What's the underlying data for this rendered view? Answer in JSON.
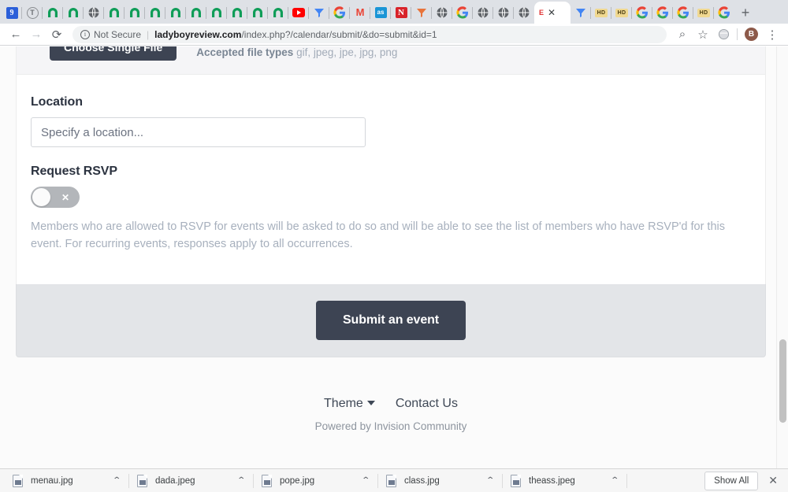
{
  "browser": {
    "tabs": [
      {
        "name": "tab-favicon-blue9",
        "icon": "blue-square-9-icon"
      },
      {
        "name": "tab-favicon-circle-t",
        "icon": "circled-t-icon"
      },
      {
        "name": "tab-favicon-arch-1",
        "icon": "green-arch-icon"
      },
      {
        "name": "tab-favicon-arch-2",
        "icon": "green-arch-icon"
      },
      {
        "name": "tab-favicon-globe-1",
        "icon": "globe-icon"
      },
      {
        "name": "tab-favicon-arch-3",
        "icon": "green-arch-icon"
      },
      {
        "name": "tab-favicon-arch-4",
        "icon": "green-arch-icon"
      },
      {
        "name": "tab-favicon-arch-5",
        "icon": "green-arch-icon"
      },
      {
        "name": "tab-favicon-arch-6",
        "icon": "green-arch-icon"
      },
      {
        "name": "tab-favicon-arch-7",
        "icon": "green-arch-icon"
      },
      {
        "name": "tab-favicon-arch-8",
        "icon": "green-arch-icon"
      },
      {
        "name": "tab-favicon-arch-9",
        "icon": "green-arch-icon"
      },
      {
        "name": "tab-favicon-arch-10",
        "icon": "green-arch-icon"
      },
      {
        "name": "tab-favicon-arch-11",
        "icon": "green-arch-icon"
      },
      {
        "name": "tab-favicon-youtube",
        "icon": "youtube-icon"
      },
      {
        "name": "tab-favicon-vimeo-1",
        "icon": "blue-funnel-icon"
      },
      {
        "name": "tab-favicon-google-1",
        "icon": "google-g-icon",
        "label": "G"
      },
      {
        "name": "tab-favicon-gmail",
        "icon": "gmail-m-icon",
        "label": "M"
      },
      {
        "name": "tab-favicon-as",
        "icon": "blue-as-icon",
        "label": "as"
      },
      {
        "name": "tab-favicon-n",
        "icon": "red-n-icon",
        "label": "N"
      },
      {
        "name": "tab-favicon-vimeo-2",
        "icon": "blue-funnel-icon"
      },
      {
        "name": "tab-favicon-globe-2",
        "icon": "globe-icon"
      },
      {
        "name": "tab-favicon-google-2",
        "icon": "google-g-icon",
        "label": "G"
      },
      {
        "name": "tab-favicon-globe-3",
        "icon": "globe-icon"
      },
      {
        "name": "tab-favicon-globe-4",
        "icon": "globe-icon"
      },
      {
        "name": "tab-favicon-globe-5",
        "icon": "globe-icon"
      }
    ],
    "active_tab": {
      "favicon": "red-text-icon",
      "favicon_label": "E",
      "close_label": "✕"
    },
    "tabs_after_active": [
      {
        "name": "tab-favicon-vimeo-3",
        "icon": "blue-funnel-icon"
      },
      {
        "name": "tab-favicon-hd-1",
        "icon": "hd-badge-icon",
        "label": "HD"
      },
      {
        "name": "tab-favicon-hd-2",
        "icon": "hd-badge-icon",
        "label": "HD"
      },
      {
        "name": "tab-favicon-google-3",
        "icon": "google-g-icon",
        "label": "G"
      },
      {
        "name": "tab-favicon-google-4",
        "icon": "google-g-icon",
        "label": "G"
      },
      {
        "name": "tab-favicon-google-5",
        "icon": "google-g-icon",
        "label": "G"
      },
      {
        "name": "tab-favicon-hd-3",
        "icon": "hd-badge-icon",
        "label": "HD"
      },
      {
        "name": "tab-favicon-google-6",
        "icon": "google-g-icon",
        "label": "G"
      }
    ],
    "new_tab_label": "+",
    "toolbar": {
      "back_label": "←",
      "forward_label": "→",
      "reload_label": "⟳",
      "info_label": "i",
      "security_text": "Not Secure",
      "divider": "|",
      "url_host": "ladyboyreview.com",
      "url_path": "/index.php?/calendar/submit/&do=submit&id=1",
      "zoom_label": "⌕",
      "bookmark_label": "☆",
      "extension_label": "●",
      "avatar_label": "B",
      "menu_label": "⋮"
    }
  },
  "page": {
    "upload": {
      "choose_button_label": "Choose Single File",
      "accepted_label": "Accepted file types",
      "accepted_types": "gif, jpeg, jpe, jpg, png"
    },
    "location": {
      "label": "Location",
      "placeholder": "Specify a location...",
      "value": ""
    },
    "rsvp": {
      "label": "Request RSVP",
      "toggle_state": "off",
      "toggle_glyph": "✕",
      "description": "Members who are allowed to RSVP for events will be asked to do so and will be able to see the list of members who have RSVP'd for this event. For recurring events, responses apply to all occurrences."
    },
    "submit_button_label": "Submit an event",
    "footer": {
      "theme_label": "Theme",
      "contact_label": "Contact Us",
      "powered_by": "Powered by Invision Community"
    }
  },
  "downloads": {
    "items": [
      {
        "filename": "menau.jpg",
        "menu_label": "⌃"
      },
      {
        "filename": "dada.jpeg",
        "menu_label": "⌃"
      },
      {
        "filename": "pope.jpg",
        "menu_label": "⌃"
      },
      {
        "filename": "class.jpg",
        "menu_label": "⌃"
      },
      {
        "filename": "theass.jpeg",
        "menu_label": "⌃"
      }
    ],
    "show_all_label": "Show All",
    "close_label": "✕"
  },
  "colors": {
    "accent_dark": "#3d4453",
    "page_bg": "#fbfbfb",
    "panel_bg": "#ffffff",
    "footer_bar": "#e3e5e8",
    "muted_text": "#a7b0bd",
    "heading": "#2c3340"
  }
}
